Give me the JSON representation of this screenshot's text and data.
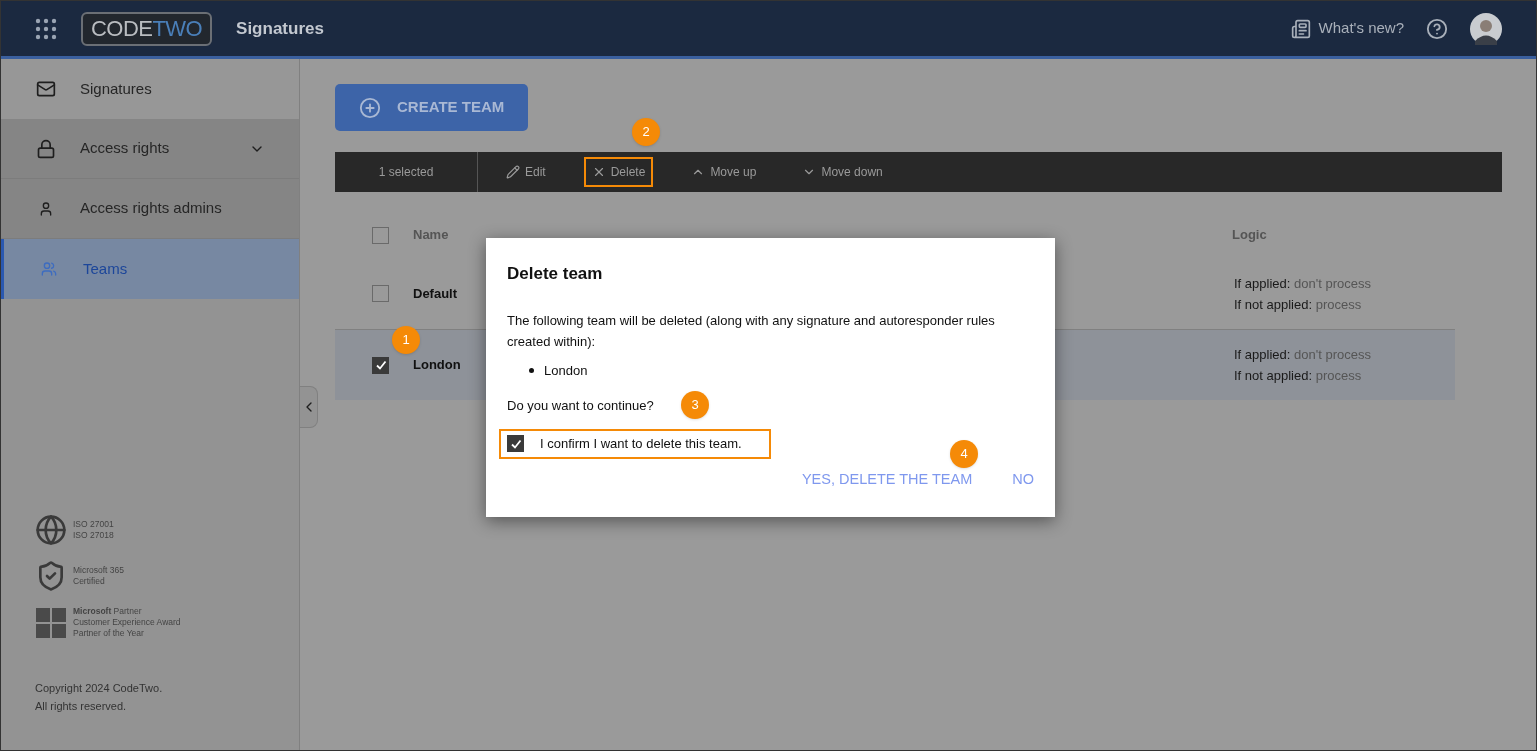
{
  "header": {
    "brand_left": "CODE",
    "brand_right": "TWO",
    "app_title": "Signatures",
    "whats_new": "What's new?"
  },
  "sidebar": {
    "items": [
      {
        "label": "Signatures",
        "kind": "signatures",
        "selected": false,
        "expandable": false,
        "group": false
      },
      {
        "label": "Access rights",
        "kind": "lock",
        "selected": false,
        "expandable": true,
        "group": true
      },
      {
        "label": "Access rights admins",
        "kind": "person",
        "selected": false,
        "expandable": false,
        "group": true
      },
      {
        "label": "Teams",
        "kind": "people",
        "selected": true,
        "expandable": false,
        "group": false
      }
    ],
    "badges": [
      {
        "kind": "globe",
        "lines": [
          "ISO 27001",
          "ISO 27018"
        ]
      },
      {
        "kind": "shield",
        "lines": [
          "Microsoft 365",
          "Certified"
        ]
      },
      {
        "kind": "windows",
        "lines": [
          "**Microsoft** Partner",
          "Customer Experience Award",
          "Partner of the Year"
        ]
      }
    ],
    "copyright": [
      "Copyright 2024 CodeTwo.",
      "All rights reserved."
    ]
  },
  "create_button": "CREATE TEAM",
  "toolbar": {
    "selection": "1 selected",
    "actions": [
      {
        "label": "Edit",
        "kind": "edit",
        "highlighted": false
      },
      {
        "label": "Delete",
        "kind": "delete",
        "highlighted": true
      },
      {
        "label": "Move up",
        "kind": "up",
        "highlighted": false
      },
      {
        "label": "Move down",
        "kind": "down",
        "highlighted": false
      }
    ]
  },
  "table": {
    "all_checked": false,
    "columns": [
      "Name",
      "Logic"
    ],
    "rows": [
      {
        "name": "Default",
        "selected": false,
        "logic": [
          {
            "label": "If applied:",
            "value": "don't process"
          },
          {
            "label": "If not applied:",
            "value": "process"
          }
        ]
      },
      {
        "name": "London",
        "selected": true,
        "logic": [
          {
            "label": "If applied:",
            "value": "don't process"
          },
          {
            "label": "If not applied:",
            "value": "process"
          }
        ]
      }
    ]
  },
  "dialog": {
    "title": "Delete team",
    "message": "The following team will be deleted (along with any signature and autoresponder rules created within):",
    "items": [
      "London"
    ],
    "question": "Do you want to continue?",
    "confirm": {
      "label": "I confirm I want to delete this team.",
      "checked": true,
      "highlighted": true
    },
    "buttons": [
      "YES, DELETE THE TEAM",
      "NO"
    ]
  },
  "callouts": [
    "1",
    "2",
    "3",
    "4"
  ]
}
